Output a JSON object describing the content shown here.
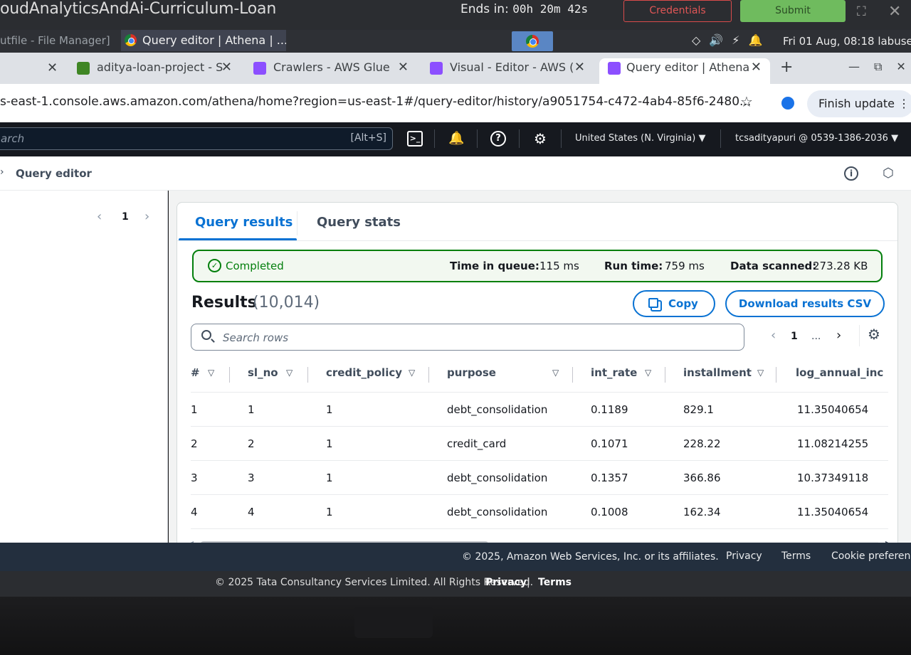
{
  "lab": {
    "title": "oudAnalyticsAndAi-Curriculum-Loan",
    "ends_label": "Ends in:",
    "ends_value": "00h 20m 42s",
    "credentials_label": "Credentials",
    "submit_label": "Submit",
    "footer_copyright": "© 2025 Tata Consultancy Services Limited. All Rights Reserved.",
    "footer_privacy": "Privacy",
    "footer_sep": "|",
    "footer_terms": "Terms"
  },
  "taskbar": {
    "file_manager": "utfile - File Manager]",
    "chrome_window": "Query editor | Athena | ...",
    "tray_icons": "◇🔊⚡🔔",
    "clock": "Fri 01 Aug, 08:18  labuse"
  },
  "browser": {
    "tabs": [
      {
        "label": "aditya-loan-project - S",
        "favicon_color": "#3f8624",
        "close": "✕"
      },
      {
        "label": "Crawlers - AWS Glue",
        "favicon_color": "#8c4fff",
        "close": "✕"
      },
      {
        "label": "Visual - Editor - AWS (",
        "favicon_color": "#8c4fff",
        "close": "✕"
      },
      {
        "label": "Query editor | Athena",
        "favicon_color": "#8c4fff",
        "close": "✕"
      }
    ],
    "first_tab_close": "✕",
    "new_tab": "+",
    "window_controls": "—⧉✕",
    "url": "s-east-1.console.aws.amazon.com/athena/home?region=us-east-1#/query-editor/history/a9051754-c472-4ab4-85f6-2480...",
    "bookmark_icon": "☆",
    "finish_update_label": "Finish update ⋮"
  },
  "aws_nav": {
    "search_placeholder": "arch",
    "search_shortcut": "[Alt+S]",
    "cloudshell_icon": ">_",
    "bell_icon": "🔔",
    "help_icon": "?",
    "gear_icon": "⚙",
    "region": "United States (N. Virginia) ▼",
    "account": "tcsadityapuri @ 0539-1386-2036 ▼"
  },
  "breadcrumb": {
    "chevron": "›",
    "title": "Query editor",
    "info_icon": "i",
    "settings_icon": "⬡"
  },
  "left_panel": {
    "prev": "‹",
    "page": "1",
    "next": "›"
  },
  "results_panel": {
    "tabs": [
      "Query results",
      "Query stats"
    ],
    "status": {
      "check_icon": "✓",
      "state": "Completed",
      "time_in_queue_label": "Time in queue:",
      "time_in_queue_value": "115 ms",
      "run_time_label": "Run time:",
      "run_time_value": "759 ms",
      "data_scanned_label": "Data scanned:",
      "data_scanned_value": "273.28 KB"
    },
    "results_title": "Results",
    "results_count": "(10,014)",
    "copy_label": "Copy",
    "download_label": "Download results CSV",
    "search_placeholder": "Search rows",
    "pagination": {
      "prev": "‹",
      "page": "1",
      "dots": "...",
      "next": "›",
      "settings": "⚙"
    },
    "sort_icon": "▽",
    "columns": [
      "#",
      "sl_no",
      "credit_policy",
      "purpose",
      "int_rate",
      "installment",
      "log_annual_inc"
    ],
    "rows": [
      [
        "1",
        "1",
        "1",
        "debt_consolidation",
        "0.1189",
        "829.1",
        "11.35040654"
      ],
      [
        "2",
        "2",
        "1",
        "credit_card",
        "0.1071",
        "228.22",
        "11.08214255"
      ],
      [
        "3",
        "3",
        "1",
        "debt_consolidation",
        "0.1357",
        "366.86",
        "10.37349118"
      ],
      [
        "4",
        "4",
        "1",
        "debt_consolidation",
        "0.1008",
        "162.34",
        "11.35040654"
      ]
    ],
    "scroll_left": "◂",
    "scroll_right": "▸"
  },
  "aws_footer": {
    "copyright": "© 2025, Amazon Web Services, Inc. or its affiliates.",
    "privacy": "Privacy",
    "terms": "Terms",
    "cookie": "Cookie preferences"
  }
}
